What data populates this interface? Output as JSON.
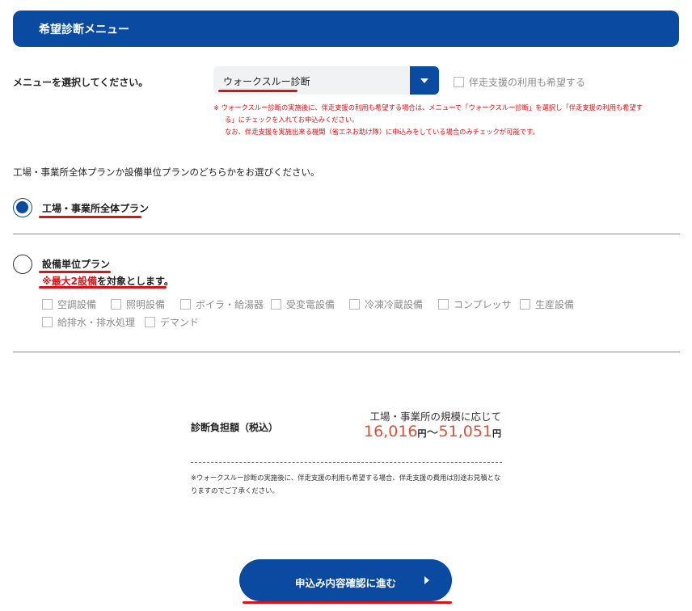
{
  "header": {
    "title": "希望診断メニュー"
  },
  "menu": {
    "label": "メニューを選択してください。",
    "selected": "ウォークスルー診断",
    "banso_option": "伴走支援の利用も希望する",
    "notes": [
      "※ ウォークスルー診断の実施後に、伴走支援の利用も希望する場合は、メニューで「ウォークスルー診断」を選択し「伴走支援の利用も希望す",
      "る」にチェックを入れてお申込みください。",
      "なお、伴走支援を実施出来る機関（省エネお助け隊）に申込みをしている場合のみチェックが可能です。"
    ]
  },
  "plan": {
    "question": "工場・事業所全体プランか設備単位プランのどちらかをお選びください。",
    "options": [
      {
        "label": "工場・事業所全体プラン",
        "checked": true
      },
      {
        "label": "設備単位プラン",
        "checked": false
      }
    ],
    "limit_prefix": "※",
    "limit_highlight": "最大2設備",
    "limit_suffix": "を対象とします。",
    "equipment": [
      "空調設備",
      "照明設備",
      "ボイラ・給湯器",
      "受変電設備",
      "冷凍冷蔵設備",
      "コンプレッサ",
      "生産設備",
      "給排水・排水処理",
      "デマンド"
    ]
  },
  "fee": {
    "label": "診断負担額（税込）",
    "scale_text": "工場・事業所の規模に応じて",
    "min": "16,016",
    "max": "51,051",
    "yen": "円",
    "tilde": "〜",
    "note": "※ウォークスルー診断の実施後に、伴走支援の利用も希望する場合、伴走支援の費用は別途お見積となりますのでご了承ください。"
  },
  "submit": {
    "label": "申込み内容確認に進む"
  },
  "colors": {
    "brand_blue": "#0a4aa0",
    "accent_red": "#d8141b",
    "price_orange": "#d9533a"
  }
}
